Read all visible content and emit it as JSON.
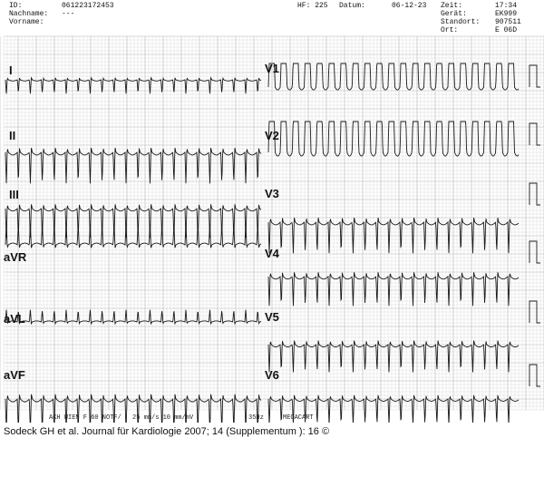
{
  "header": {
    "id_label": "ID:",
    "id_value": "061223172453",
    "nachname_label": "Nachname:",
    "nachname_value": "---",
    "vorname_label": "Vorname:",
    "hf_label": "HF: 225",
    "datum_label": "Datum:",
    "datum_value": "06-12-23",
    "zeit_label": "Zeit:",
    "zeit_value": "17:34",
    "geraet_label": "Gerät:",
    "geraet_value": "EK999",
    "standort_label": "Standort:",
    "standort_value": "907511",
    "ort_label": "Ort:",
    "ort_value": "E 06D"
  },
  "leads": {
    "I": "I",
    "II": "II",
    "III": "III",
    "aVR": "aVR",
    "aVL": "aVL",
    "aVF": "aVF",
    "V1": "V1",
    "V2": "V2",
    "V3": "V3",
    "V4": "V4",
    "V5": "V5",
    "V6": "V6"
  },
  "footer": {
    "filter": "AKH WIEN  F 60 NOTF/",
    "speed": "25 mm/s  10 mm/mV",
    "hz": "35Hz",
    "device": "MEGACART"
  },
  "citation": "Sodeck GH et al. Journal für Kardiologie 2007; 14 (Supplementum ): 16 ©",
  "colors": {
    "grid_minor": "#d6d6d6",
    "grid_major": "#b4b4b4",
    "trace": "#1a1a1a"
  }
}
